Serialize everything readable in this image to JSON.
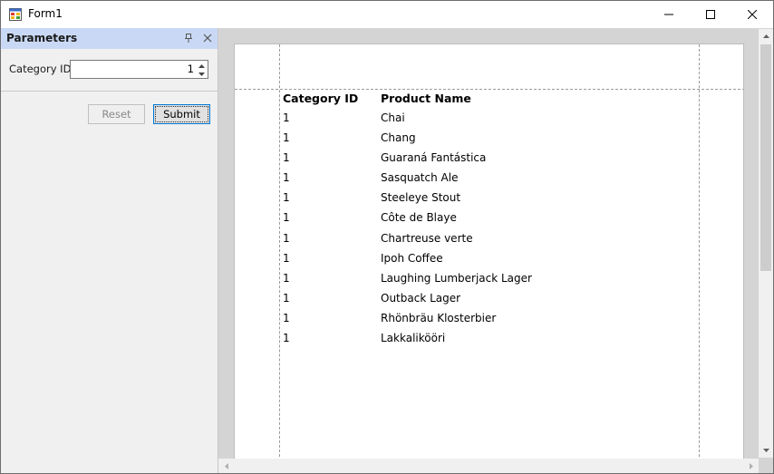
{
  "window": {
    "title": "Form1"
  },
  "panel": {
    "title": "Parameters",
    "category_label": "Category ID",
    "category_value": "1",
    "reset_label": "Reset",
    "submit_label": "Submit"
  },
  "report": {
    "headers": [
      "Category ID",
      "Product Name"
    ],
    "rows": [
      [
        "1",
        "Chai"
      ],
      [
        "1",
        "Chang"
      ],
      [
        "1",
        "Guaraná Fantástica"
      ],
      [
        "1",
        "Sasquatch Ale"
      ],
      [
        "1",
        "Steeleye Stout"
      ],
      [
        "1",
        "Côte de Blaye"
      ],
      [
        "1",
        "Chartreuse verte"
      ],
      [
        "1",
        "Ipoh Coffee"
      ],
      [
        "1",
        "Laughing Lumberjack Lager"
      ],
      [
        "1",
        "Outback Lager"
      ],
      [
        "1",
        "Rhönbräu Klosterbier"
      ],
      [
        "1",
        "Lakkalikööri"
      ]
    ]
  },
  "colors": {
    "panel_header": "#c9d9f5",
    "accent": "#0078d7"
  }
}
